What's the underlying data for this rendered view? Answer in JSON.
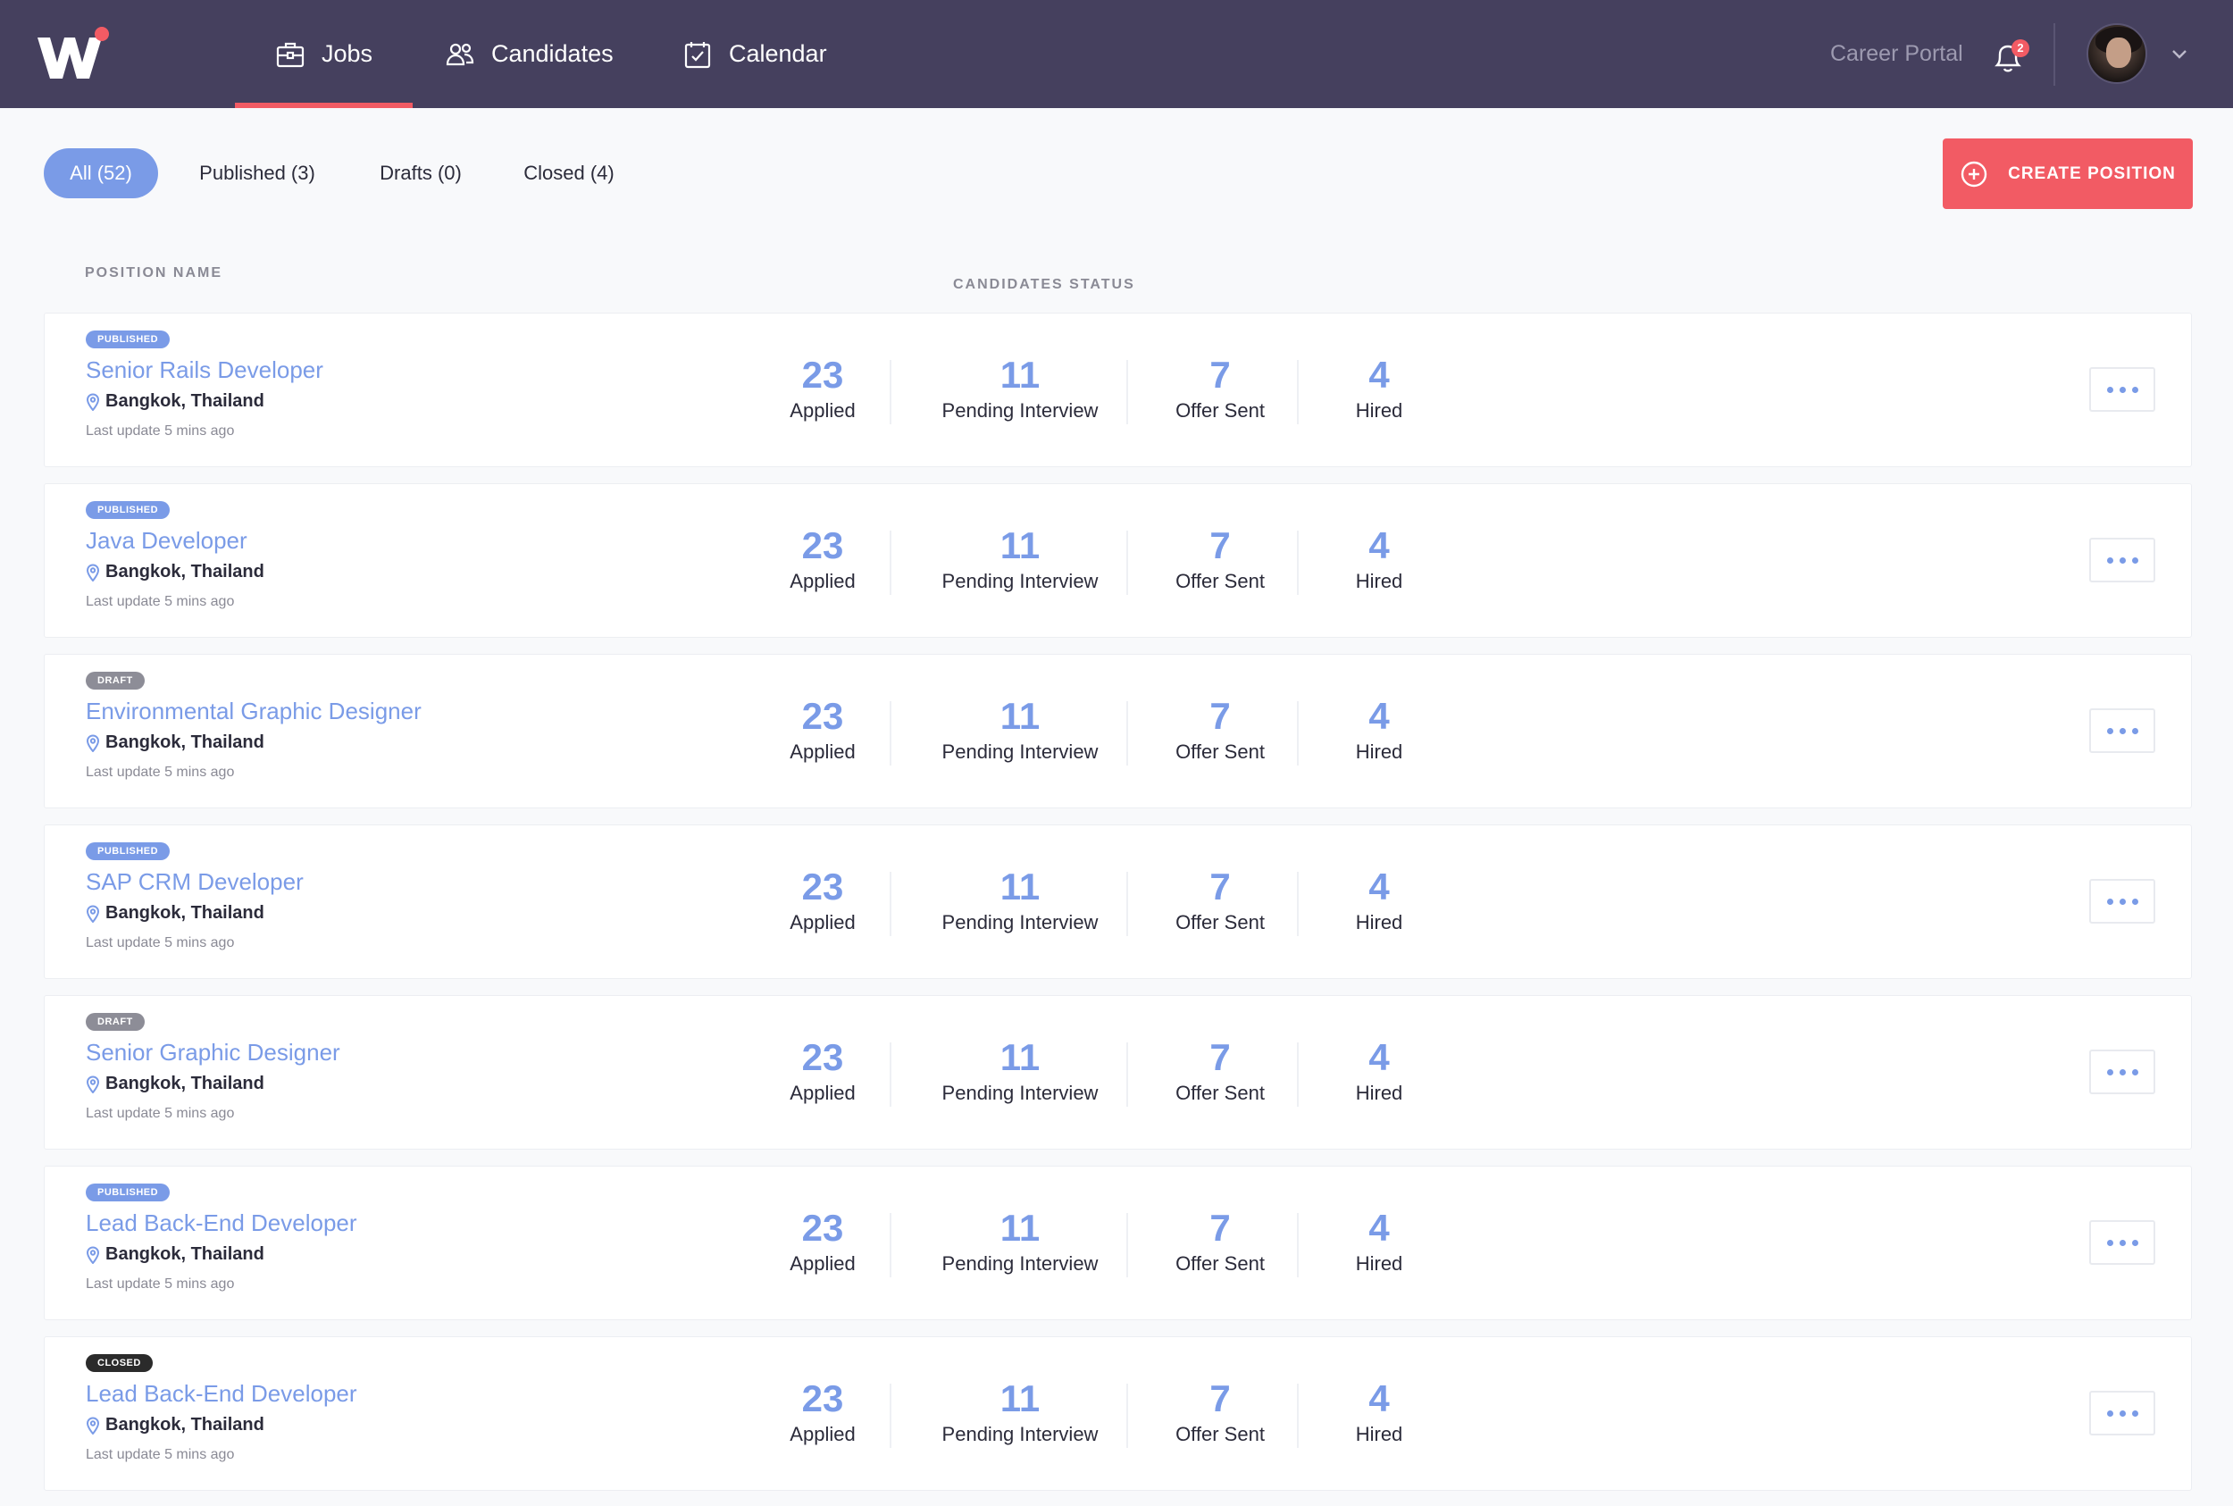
{
  "nav": {
    "items": [
      {
        "label": "Jobs",
        "icon": "briefcase-icon",
        "active": true
      },
      {
        "label": "Candidates",
        "icon": "people-icon",
        "active": false
      },
      {
        "label": "Calendar",
        "icon": "calendar-check-icon",
        "active": false
      }
    ],
    "career_portal": "Career Portal",
    "notification_count": "2"
  },
  "filters": [
    {
      "label": "All (52)",
      "active": true
    },
    {
      "label": "Published (3)",
      "active": false
    },
    {
      "label": "Drafts (0)",
      "active": false
    },
    {
      "label": "Closed (4)",
      "active": false
    }
  ],
  "create_button": "CREATE POSITION",
  "columns": {
    "position_name": "POSITION NAME",
    "candidates_status": "CANDIDATES STATUS"
  },
  "stat_labels": {
    "applied": "Applied",
    "pending": "Pending Interview",
    "offer": "Offer Sent",
    "hired": "Hired"
  },
  "positions": [
    {
      "status": "PUBLISHED",
      "title": "Senior Rails Developer",
      "location": "Bangkok, Thailand",
      "updated": "Last update 5 mins ago",
      "applied": "23",
      "pending": "11",
      "offer": "7",
      "hired": "4"
    },
    {
      "status": "PUBLISHED",
      "title": "Java Developer",
      "location": "Bangkok, Thailand",
      "updated": "Last update 5 mins ago",
      "applied": "23",
      "pending": "11",
      "offer": "7",
      "hired": "4"
    },
    {
      "status": "DRAFT",
      "title": "Environmental Graphic Designer",
      "location": "Bangkok, Thailand",
      "updated": "Last update 5 mins ago",
      "applied": "23",
      "pending": "11",
      "offer": "7",
      "hired": "4"
    },
    {
      "status": "PUBLISHED",
      "title": "SAP CRM Developer",
      "location": "Bangkok, Thailand",
      "updated": "Last update 5 mins ago",
      "applied": "23",
      "pending": "11",
      "offer": "7",
      "hired": "4"
    },
    {
      "status": "DRAFT",
      "title": "Senior Graphic Designer",
      "location": "Bangkok, Thailand",
      "updated": "Last update 5 mins ago",
      "applied": "23",
      "pending": "11",
      "offer": "7",
      "hired": "4"
    },
    {
      "status": "PUBLISHED",
      "title": "Lead Back-End Developer",
      "location": "Bangkok, Thailand",
      "updated": "Last update 5 mins ago",
      "applied": "23",
      "pending": "11",
      "offer": "7",
      "hired": "4"
    },
    {
      "status": "CLOSED",
      "title": "Lead Back-End Developer",
      "location": "Bangkok, Thailand",
      "updated": "Last update 5 mins ago",
      "applied": "23",
      "pending": "11",
      "offer": "7",
      "hired": "4"
    }
  ],
  "colors": {
    "header_bg": "#45405e",
    "accent": "#f25b64",
    "link_blue": "#7a9be7",
    "draft_grey": "#8d8d97",
    "closed_black": "#2b2b2b"
  }
}
